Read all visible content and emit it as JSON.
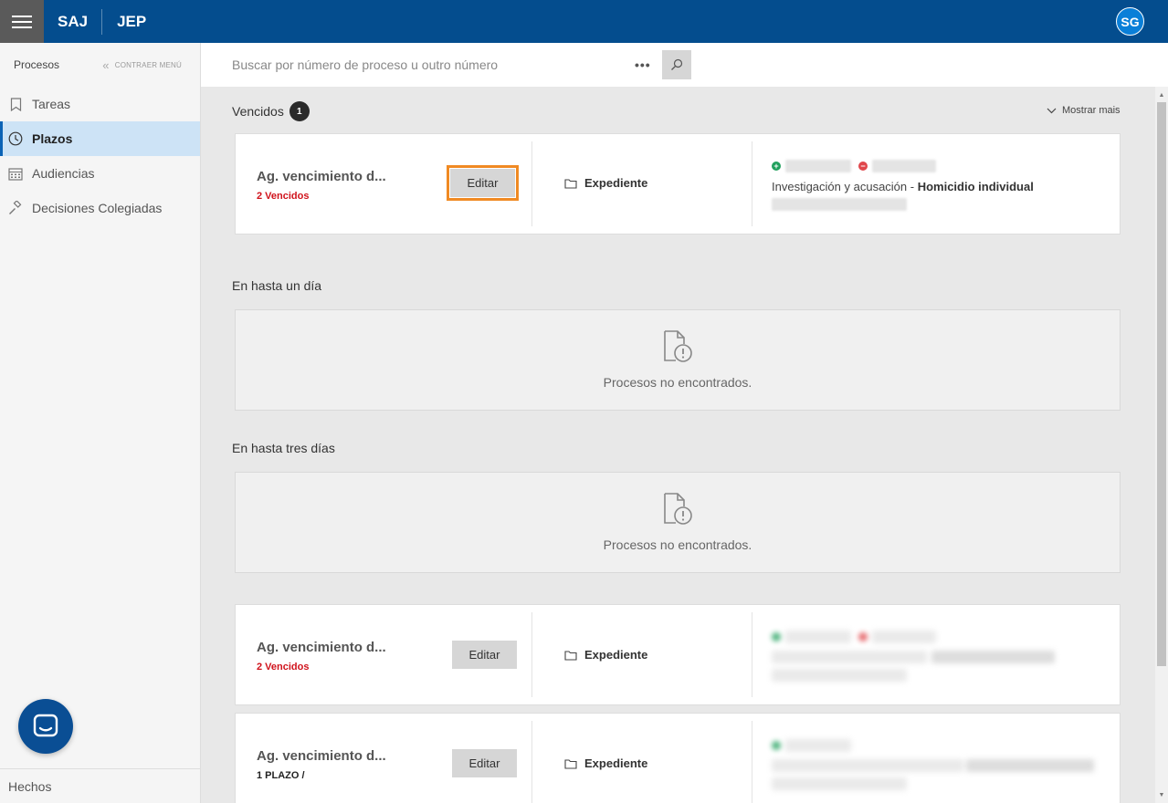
{
  "header": {
    "brand1": "SAJ",
    "brand2": "JEP",
    "avatar": "SG"
  },
  "sidebar": {
    "title": "Procesos",
    "collapse_label": "CONTRAER MENÚ",
    "items": [
      {
        "label": "Tareas",
        "icon": "bookmark-icon"
      },
      {
        "label": "Plazos",
        "icon": "clock-icon"
      },
      {
        "label": "Audiencias",
        "icon": "calendar-icon"
      },
      {
        "label": "Decisiones Colegiadas",
        "icon": "gavel-icon"
      }
    ],
    "footer": "Hechos"
  },
  "search": {
    "placeholder": "Buscar por número de proceso u outro número",
    "more": "•••"
  },
  "main": {
    "vencidos_title": "Vencidos",
    "vencidos_count": "1",
    "show_more": "Mostrar mais",
    "section_one_day": "En hasta un día",
    "section_three_days": "En hasta tres días",
    "empty_text": "Procesos no encontrados.",
    "cards": [
      {
        "title": "Ag. vencimiento d...",
        "sub": "2 Vencidos",
        "edit": "Editar",
        "expediente": "Expediente",
        "desc_prefix": "Investigación y acusación - ",
        "desc_bold": "Homicidio individual"
      },
      {
        "title": "Ag. vencimiento d...",
        "sub": "2 Vencidos",
        "edit": "Editar",
        "expediente": "Expediente"
      },
      {
        "title": "Ag. vencimiento d...",
        "sub": "1 PLAZO /",
        "edit": "Editar",
        "expediente": "Expediente"
      }
    ]
  },
  "colors": {
    "topbar": "#044d8e",
    "accent_red": "#d0121b",
    "focus_outline": "#f08a23",
    "active_nav": "#cde3f6"
  }
}
